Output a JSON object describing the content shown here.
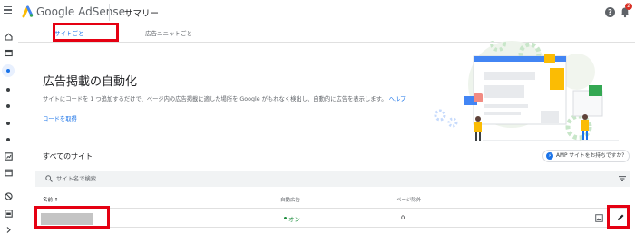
{
  "app": {
    "title": "Google AdSense",
    "page_heading": "サマリー",
    "notification_count": "2"
  },
  "tabs": [
    {
      "label": "サイトごと",
      "active": true
    },
    {
      "label": "広告ユニットごと",
      "active": false
    }
  ],
  "intro": {
    "title": "広告掲載の自動化",
    "description": "サイトにコードを 1 つ追加するだけで、ページ内の広告掲載に適した場所を Google がもれなく検出し、自動的に広告を表示します。",
    "help_link": "ヘルプ",
    "get_code_link": "コードを取得"
  },
  "sites": {
    "title": "すべてのサイト",
    "amp_chip": "AMP サイトをお持ちですか？",
    "search_placeholder": "サイト名で検索",
    "columns": {
      "name": "名前 ↑",
      "auto_ads": "自動広告",
      "pages": "ページ除外"
    },
    "rows": [
      {
        "name": "",
        "auto_ads_status": "オン",
        "page_exclusions": "0"
      }
    ]
  },
  "colors": {
    "accent": "#1a73e8",
    "highlight": "#e50012",
    "status_on": "#1e8e3e"
  },
  "icons": [
    "menu-icon",
    "adsense-logo-icon",
    "help-icon",
    "bell-icon",
    "home-icon",
    "sites-icon",
    "search-icon",
    "filter-icon",
    "image-icon",
    "edit-icon"
  ]
}
